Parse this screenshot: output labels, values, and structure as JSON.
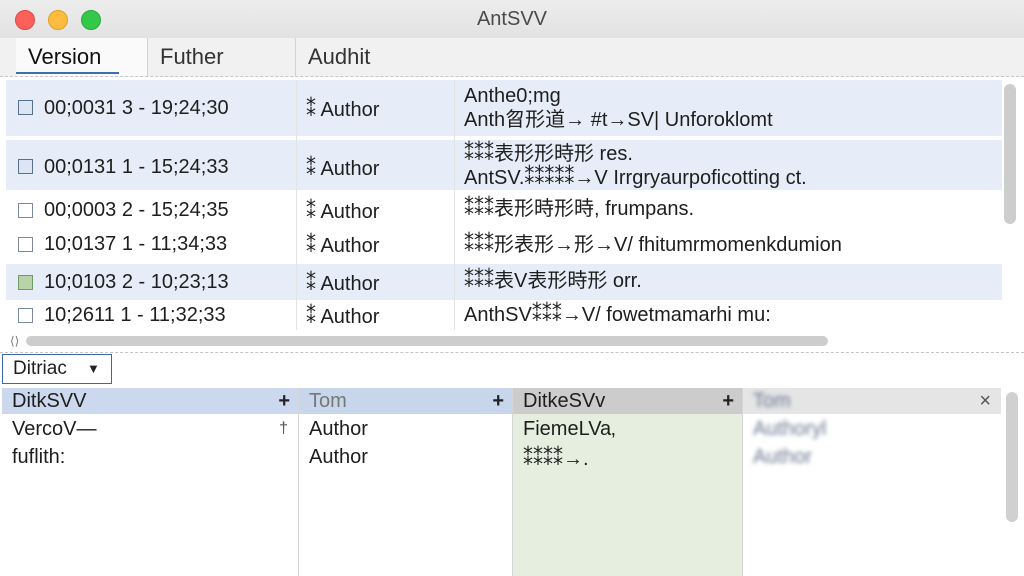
{
  "window": {
    "title": "AntSVV"
  },
  "tabs": [
    {
      "label": "Version"
    },
    {
      "label": "Futher"
    },
    {
      "label": "Audhit"
    }
  ],
  "commits": [
    {
      "date": "00;0031 3   - 19;24;30",
      "author": "⁑ Author",
      "msg1": "Anthe0;mg",
      "msg2": "Anth曶形道→ #t→SV| Unforoklomt",
      "selected": true,
      "checked": false
    },
    {
      "date": "00;0131 1   - 15;24;33",
      "author": "⁑ Author",
      "msg1": "⁑⁑⁑表形形時形 res.",
      "msg2": "AntSV.⁑⁑⁑⁑⁑→V Irrgryaurpoficotting ct.",
      "selected": true,
      "checked": false
    },
    {
      "date": "00;0003 2   - 15;24;35",
      "author": "⁑ Author",
      "msg1": "⁑⁑⁑表形時形時, frumpans.",
      "msg2": "",
      "selected": false,
      "checked": false
    },
    {
      "date": "10;0137 1   - 11;34;33",
      "author": "⁑ Author",
      "msg1": "⁑⁑⁑形表形→形→V/ fhitumrmomenkdumion",
      "msg2": "",
      "selected": false,
      "checked": false
    },
    {
      "date": "10;0103 2   - 10;23;13",
      "author": "⁑ Author",
      "msg1": "⁑⁑⁑表V表形時形 orr.",
      "msg2": "",
      "selected": true,
      "checked": true
    },
    {
      "date": "10;2611 1   - 11;32;33",
      "author": "⁑ Author",
      "msg1": "AnthSV⁑⁑⁑→V/ fowetmamarhi mu:",
      "msg2": "",
      "selected": false,
      "checked": false
    }
  ],
  "filter": {
    "label": "Ditriac"
  },
  "panels": [
    {
      "header": "DitkSVV",
      "items": [
        "VercoV—",
        "fuflith:"
      ]
    },
    {
      "header": "Tom",
      "items": [
        "Author",
        "Author"
      ]
    },
    {
      "header": "DitkeSVv",
      "items": [
        "FiemeLVa‚",
        "⁑⁑⁑⁑→."
      ]
    },
    {
      "header": "Tom",
      "items": [
        "Authoryl",
        "Author"
      ]
    }
  ],
  "icons": {
    "plus": "+",
    "close": "×",
    "caret": "▼",
    "pin": "†",
    "scroll_left": "⟨⟩"
  }
}
